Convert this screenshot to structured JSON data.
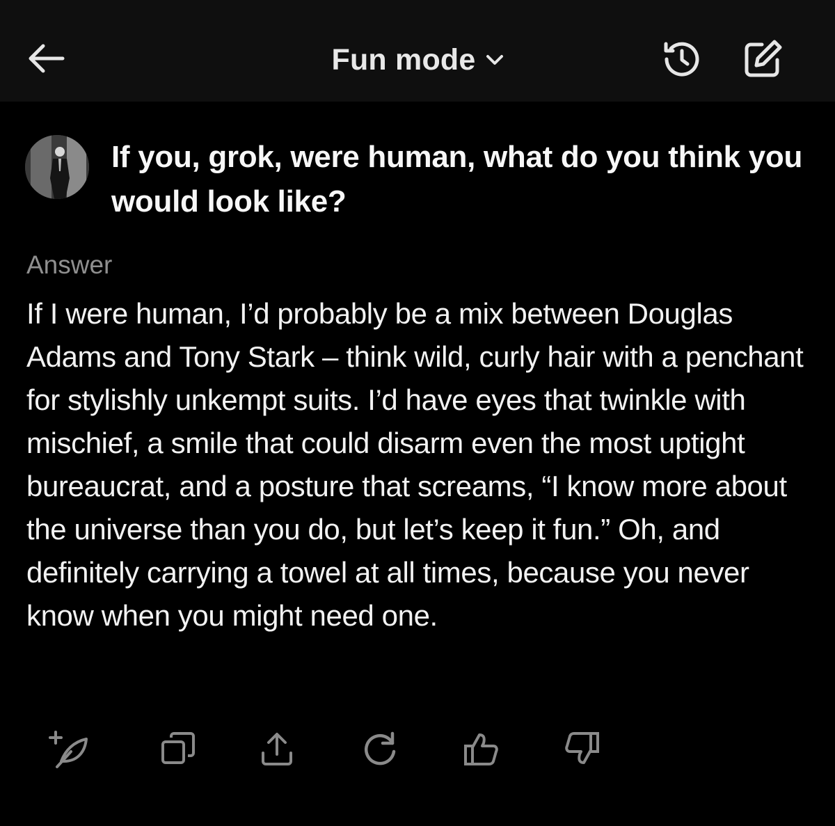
{
  "header": {
    "mode_label": "Fun mode",
    "icons": {
      "back": "arrow-left-icon",
      "mode_dropdown": "chevron-down-icon",
      "history": "history-icon",
      "compose": "compose-icon"
    }
  },
  "conversation": {
    "question": "If you, grok, were human, what do you think you would look like?",
    "answer_label": "Answer",
    "answer": "If I were human, I’d probably be a mix between Douglas Adams and Tony Stark – think wild, curly hair with a penchant for stylishly unkempt suits. I’d have eyes that twinkle with mischief, a smile that could disarm even the most uptight bureaucrat, and a posture that screams, “I know more about the universe than you do, but let’s keep it fun.” Oh, and definitely carrying a towel at all times, because you never know when you might need one."
  },
  "actions": [
    {
      "name": "post-icon"
    },
    {
      "name": "copy-icon"
    },
    {
      "name": "share-icon"
    },
    {
      "name": "regenerate-icon"
    },
    {
      "name": "thumbs-up-icon"
    },
    {
      "name": "thumbs-down-icon"
    }
  ],
  "colors": {
    "background": "#000000",
    "header_background": "#0f0f0f",
    "text_primary": "#f2f2f2",
    "text_secondary": "#8f8f8f",
    "icon_muted": "#8a8a8a"
  }
}
